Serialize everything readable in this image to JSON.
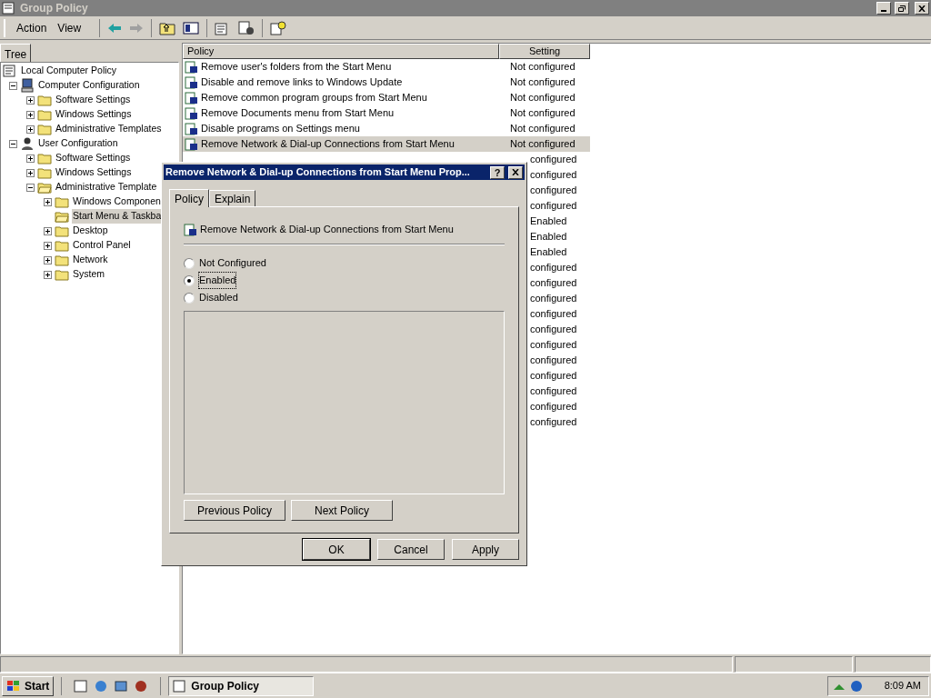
{
  "window": {
    "title": "Group Policy"
  },
  "menu": [
    "Action",
    "View"
  ],
  "tree_tab": "Tree",
  "columns": [
    "Policy",
    "Setting"
  ],
  "tree": [
    {
      "label": "Local Computer Policy",
      "kind": "root",
      "expandable": false,
      "expanded": true,
      "selected": false,
      "children": [
        {
          "label": "Computer Configuration",
          "kind": "computer",
          "expandable": true,
          "expanded": true,
          "selected": false,
          "children": [
            {
              "label": "Software Settings",
              "kind": "folder",
              "expandable": true,
              "expanded": false,
              "selected": false
            },
            {
              "label": "Windows Settings",
              "kind": "folder",
              "expandable": true,
              "expanded": false,
              "selected": false
            },
            {
              "label": "Administrative Templates",
              "kind": "folder",
              "expandable": true,
              "expanded": false,
              "selected": false
            }
          ]
        },
        {
          "label": "User Configuration",
          "kind": "user",
          "expandable": true,
          "expanded": true,
          "selected": false,
          "children": [
            {
              "label": "Software Settings",
              "kind": "folder",
              "expandable": true,
              "expanded": false,
              "selected": false
            },
            {
              "label": "Windows Settings",
              "kind": "folder",
              "expandable": true,
              "expanded": false,
              "selected": false
            },
            {
              "label": "Administrative Template",
              "kind": "folder",
              "expandable": true,
              "expanded": true,
              "selected": false,
              "children": [
                {
                  "label": "Windows Componen",
                  "kind": "folder",
                  "expandable": true,
                  "expanded": false,
                  "selected": false
                },
                {
                  "label": "Start Menu & Taskba",
                  "kind": "folder",
                  "expandable": false,
                  "expanded": true,
                  "selected": true
                },
                {
                  "label": "Desktop",
                  "kind": "folder",
                  "expandable": true,
                  "expanded": false,
                  "selected": false
                },
                {
                  "label": "Control Panel",
                  "kind": "folder",
                  "expandable": true,
                  "expanded": false,
                  "selected": false
                },
                {
                  "label": "Network",
                  "kind": "folder",
                  "expandable": true,
                  "expanded": false,
                  "selected": false
                },
                {
                  "label": "System",
                  "kind": "folder",
                  "expandable": true,
                  "expanded": false,
                  "selected": false
                }
              ]
            }
          ]
        }
      ]
    }
  ],
  "rows": [
    {
      "policy": "Remove user's folders from the Start Menu",
      "setting": "Not configured",
      "selected": false
    },
    {
      "policy": "Disable and remove links to Windows Update",
      "setting": "Not configured",
      "selected": false
    },
    {
      "policy": "Remove common program groups from Start Menu",
      "setting": "Not configured",
      "selected": false
    },
    {
      "policy": "Remove Documents menu from Start Menu",
      "setting": "Not configured",
      "selected": false
    },
    {
      "policy": "Disable programs on Settings menu",
      "setting": "Not configured",
      "selected": false
    },
    {
      "policy": "Remove Network & Dial-up Connections from Start Menu",
      "setting": "Not configured",
      "selected": true
    },
    {
      "setting": "configured",
      "selected": false
    },
    {
      "setting": "configured",
      "selected": false
    },
    {
      "setting": "configured",
      "selected": false
    },
    {
      "setting": "configured",
      "selected": false
    },
    {
      "setting": "Enabled",
      "selected": false
    },
    {
      "setting": "Enabled",
      "selected": false
    },
    {
      "setting": "Enabled",
      "selected": false
    },
    {
      "setting": "configured",
      "selected": false
    },
    {
      "setting": "configured",
      "selected": false
    },
    {
      "setting": "configured",
      "selected": false
    },
    {
      "setting": "configured",
      "selected": false
    },
    {
      "setting": "configured",
      "selected": false
    },
    {
      "setting": "configured",
      "selected": false
    },
    {
      "setting": "configured",
      "selected": false
    },
    {
      "setting": "configured",
      "selected": false
    },
    {
      "setting": "configured",
      "selected": false
    },
    {
      "setting": "configured",
      "selected": false
    },
    {
      "setting": "configured",
      "selected": false
    }
  ],
  "dialog": {
    "title": "Remove Network & Dial-up Connections from Start Menu Prop...",
    "help": "?",
    "tabs": [
      {
        "label": "Policy",
        "selected": true
      },
      {
        "label": "Explain",
        "selected": false
      }
    ],
    "policy_name": "Remove Network & Dial-up Connections from Start Menu",
    "options": [
      {
        "label": "Not Configured",
        "selected": false
      },
      {
        "label": "Enabled",
        "selected": true
      },
      {
        "label": "Disabled",
        "selected": false
      }
    ],
    "nav_buttons": [
      "Previous Policy",
      "Next Policy"
    ],
    "buttons": [
      {
        "label": "OK",
        "default": true
      },
      {
        "label": "Cancel",
        "default": false
      },
      {
        "label": "Apply",
        "default": false
      }
    ]
  },
  "taskbar": {
    "start": "Start",
    "task": "Group Policy",
    "clock": "8:09 AM"
  }
}
